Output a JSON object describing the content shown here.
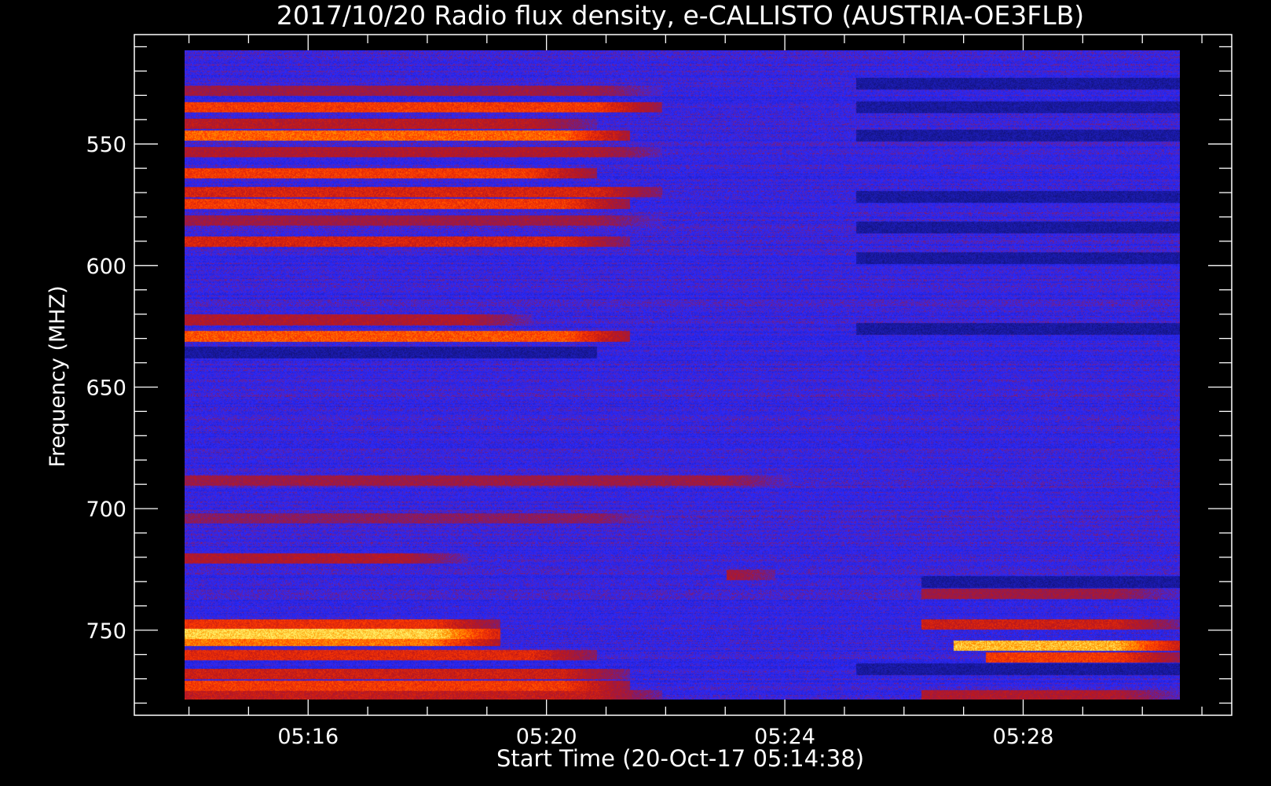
{
  "chart_data": {
    "type": "heatmap",
    "title": "2017/10/20  Radio flux density, e-CALLISTO (AUSTRIA-OE3FLB)",
    "xlabel": "Start Time (20-Oct-17 05:14:38)",
    "ylabel": "Frequency (MHZ)",
    "x_start": "05:14:38",
    "x_end": "05:30:00",
    "xlim": [
      "05:13:05",
      "05:31:30"
    ],
    "ylim": [
      785,
      505
    ],
    "y_data_range": [
      510,
      785
    ],
    "y_inverted": true,
    "x_ticks": [
      {
        "label": "05:16",
        "time": "05:16:00"
      },
      {
        "label": "05:20",
        "time": "05:20:00"
      },
      {
        "label": "05:24",
        "time": "05:24:00"
      },
      {
        "label": "05:28",
        "time": "05:28:00"
      }
    ],
    "y_ticks": [
      550,
      600,
      650,
      700,
      750
    ],
    "colormap": [
      "#000000",
      "#1a1aa8",
      "#2a2aff",
      "#8b1a5a",
      "#c01818",
      "#ff3a00",
      "#ff9900",
      "#ffee66"
    ],
    "background_level": 0.45,
    "bands": [
      {
        "freq": 527,
        "level": 0.62,
        "t_from": "05:14:38",
        "t_to": "05:22:00"
      },
      {
        "freq": 534,
        "level": 0.8,
        "t_from": "05:14:38",
        "t_to": "05:22:00"
      },
      {
        "freq": 541,
        "level": 0.68,
        "t_from": "05:14:38",
        "t_to": "05:21:00"
      },
      {
        "freq": 546,
        "level": 0.86,
        "t_from": "05:14:38",
        "t_to": "05:21:30"
      },
      {
        "freq": 553,
        "level": 0.66,
        "t_from": "05:14:38",
        "t_to": "05:22:00"
      },
      {
        "freq": 562,
        "level": 0.8,
        "t_from": "05:14:38",
        "t_to": "05:21:00"
      },
      {
        "freq": 570,
        "level": 0.74,
        "t_from": "05:14:38",
        "t_to": "05:22:00"
      },
      {
        "freq": 575,
        "level": 0.8,
        "t_from": "05:14:38",
        "t_to": "05:21:30"
      },
      {
        "freq": 582,
        "level": 0.62,
        "t_from": "05:14:38",
        "t_to": "05:22:00"
      },
      {
        "freq": 591,
        "level": 0.74,
        "t_from": "05:14:38",
        "t_to": "05:21:30"
      },
      {
        "freq": 624,
        "level": 0.66,
        "t_from": "05:14:38",
        "t_to": "05:20:00"
      },
      {
        "freq": 631,
        "level": 0.84,
        "t_from": "05:14:38",
        "t_to": "05:21:30"
      },
      {
        "freq": 692,
        "level": 0.62,
        "t_from": "05:14:38",
        "t_to": "05:24:00"
      },
      {
        "freq": 708,
        "level": 0.58,
        "t_from": "05:14:38",
        "t_to": "05:22:00"
      },
      {
        "freq": 725,
        "level": 0.66,
        "t_from": "05:14:38",
        "t_to": "05:19:00"
      },
      {
        "freq": 732,
        "level": 0.7,
        "t_from": "05:23:00",
        "t_to": "05:23:45"
      },
      {
        "freq": 740,
        "level": 0.62,
        "t_from": "05:26:00",
        "t_to": "05:30:00"
      },
      {
        "freq": 753,
        "level": 0.78,
        "t_from": "05:14:38",
        "t_to": "05:19:30"
      },
      {
        "freq": 753,
        "level": 0.72,
        "t_from": "05:26:00",
        "t_to": "05:30:00"
      },
      {
        "freq": 757,
        "level": 0.98,
        "t_from": "05:14:38",
        "t_to": "05:19:30"
      },
      {
        "freq": 760,
        "level": 0.88,
        "t_from": "05:14:38",
        "t_to": "05:19:30"
      },
      {
        "freq": 762,
        "level": 0.95,
        "t_from": "05:26:30",
        "t_to": "05:30:00"
      },
      {
        "freq": 766,
        "level": 0.76,
        "t_from": "05:14:38",
        "t_to": "05:21:00"
      },
      {
        "freq": 767,
        "level": 0.8,
        "t_from": "05:27:00",
        "t_to": "05:30:00"
      },
      {
        "freq": 774,
        "level": 0.72,
        "t_from": "05:14:38",
        "t_to": "05:21:30"
      },
      {
        "freq": 779,
        "level": 0.8,
        "t_from": "05:14:38",
        "t_to": "05:21:30"
      },
      {
        "freq": 783,
        "level": 0.7,
        "t_from": "05:14:38",
        "t_to": "05:22:00"
      },
      {
        "freq": 783,
        "level": 0.66,
        "t_from": "05:26:00",
        "t_to": "05:30:00"
      }
    ],
    "dark_bands": [
      {
        "freq": 524,
        "t_from": "05:25:00",
        "t_to": "05:30:00"
      },
      {
        "freq": 534,
        "t_from": "05:25:00",
        "t_to": "05:30:00"
      },
      {
        "freq": 546,
        "t_from": "05:25:00",
        "t_to": "05:30:00"
      },
      {
        "freq": 572,
        "t_from": "05:25:00",
        "t_to": "05:30:00"
      },
      {
        "freq": 585,
        "t_from": "05:25:00",
        "t_to": "05:30:00"
      },
      {
        "freq": 598,
        "t_from": "05:25:00",
        "t_to": "05:30:00"
      },
      {
        "freq": 628,
        "t_from": "05:25:00",
        "t_to": "05:30:00"
      },
      {
        "freq": 638,
        "t_from": "05:14:38",
        "t_to": "05:21:00"
      },
      {
        "freq": 735,
        "t_from": "05:26:00",
        "t_to": "05:30:00"
      },
      {
        "freq": 772,
        "t_from": "05:25:00",
        "t_to": "05:30:00"
      }
    ]
  }
}
